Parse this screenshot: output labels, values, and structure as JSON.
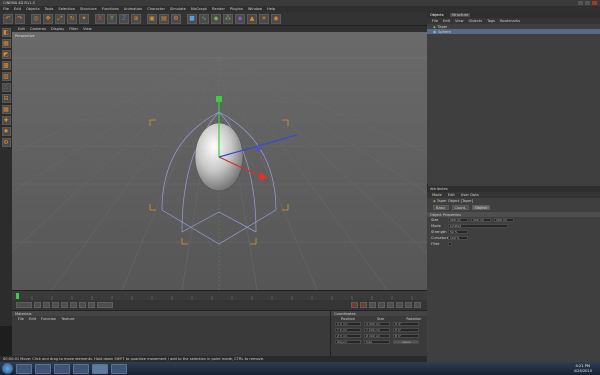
{
  "titlebar": {
    "title": "CINEMA 4D R11.5"
  },
  "menubar": {
    "items": [
      "File",
      "Edit",
      "Objects",
      "Tools",
      "Selection",
      "Structure",
      "Functions",
      "Animation",
      "Character",
      "Simulate",
      "MoGraph",
      "Render",
      "Plugins",
      "Window",
      "Help"
    ]
  },
  "viewport": {
    "menu": [
      "Edit",
      "Cameras",
      "Display",
      "Filter",
      "View"
    ],
    "label": "Perspective"
  },
  "statusbar": {
    "text": "00:00:01  Move: Click and drag to move elements. Hold down SHIFT to quantize movement / add to the selection in point mode, CTRL to remove."
  },
  "materials": {
    "title": "Materials",
    "menu": [
      "File",
      "Edit",
      "Function",
      "Texture"
    ]
  },
  "coordinates": {
    "title": "Coordinates",
    "columns": [
      "Position",
      "Size",
      "Rotation"
    ],
    "rows": [
      {
        "p": "X  0 cm",
        "s": "X  200 cm",
        "r": "H  0°"
      },
      {
        "p": "Y  0 cm",
        "s": "Y  200 cm",
        "r": "P  0°"
      },
      {
        "p": "Z  0 cm",
        "s": "Z  200 cm",
        "r": "B  0°"
      }
    ],
    "mode": "Object",
    "size_mode": "Size",
    "apply_label": "Apply"
  },
  "object_manager": {
    "tabs": [
      "Objects",
      "Structure"
    ],
    "menu": [
      "File",
      "Edit",
      "View",
      "Objects",
      "Tags",
      "Bookmarks"
    ],
    "items": [
      {
        "name": "Taper"
      },
      {
        "name": "Sphere"
      }
    ]
  },
  "attributes": {
    "title": "Attributes",
    "menu": [
      "Mode",
      "Edit",
      "User Data"
    ],
    "object_title": "Taper Object [Taper]",
    "tabs": [
      "Basic",
      "Coord.",
      "Object"
    ],
    "section": "Object Properties",
    "props": [
      {
        "label": "Size",
        "values": [
          "200 cm",
          "200 cm",
          "200 cm"
        ]
      },
      {
        "label": "Mode",
        "values": [
          "Limited"
        ]
      },
      {
        "label": "Strength",
        "values": [
          "50 %"
        ]
      },
      {
        "label": "Curvature",
        "values": [
          "100 %"
        ]
      },
      {
        "label": "Fillet",
        "values": [
          ""
        ]
      }
    ]
  },
  "taskbar": {
    "time": "4:21 PM",
    "date": "4/26/2010"
  },
  "icons": [
    "undo-icon",
    "redo-icon",
    "live-selection-icon",
    "move-icon",
    "scale-icon",
    "rotate-icon",
    "x-axis-icon",
    "y-axis-icon",
    "z-axis-icon",
    "world-coords-icon",
    "render-view-icon",
    "render-pic-icon",
    "render-settings-icon",
    "cube-icon",
    "spline-icon",
    "nurbs-icon",
    "array-icon",
    "deformer-icon",
    "scene-icon",
    "light-icon",
    "camera-icon"
  ]
}
